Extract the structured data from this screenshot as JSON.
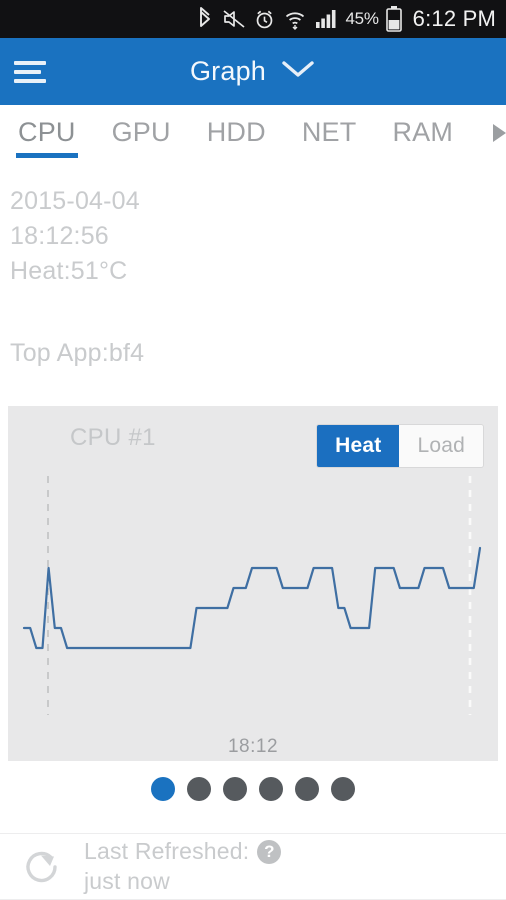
{
  "statusbar": {
    "icons": [
      "bluetooth-icon",
      "mute-icon",
      "alarm-icon",
      "wifi-icon",
      "signal-icon"
    ],
    "battery_percent": "45%",
    "time": "6:12 PM"
  },
  "appbar": {
    "menu_icon": "hamburger-menu-icon",
    "title": "Graph",
    "dropdown_icon": "chevron-down-icon",
    "color": "#1a72c0"
  },
  "tabs": {
    "items": [
      {
        "label": "CPU",
        "active": true
      },
      {
        "label": "GPU",
        "active": false
      },
      {
        "label": "HDD",
        "active": false
      },
      {
        "label": "NET",
        "active": false
      },
      {
        "label": "RAM",
        "active": false
      }
    ],
    "overflow_icon": "caret-right-icon",
    "indicator_color": "#1a72c0"
  },
  "info": {
    "date": "2015-04-04",
    "time": "18:12:56",
    "heat": "Heat:51°C",
    "top_app": "Top App:bf4"
  },
  "chart_card": {
    "title": "CPU #1",
    "toggle": {
      "selected": "Heat",
      "options": [
        "Heat",
        "Load"
      ],
      "selected_color": "#1b6fc0"
    }
  },
  "chart_data": {
    "type": "line",
    "title": "CPU #1",
    "xlabel": "",
    "ylabel": "",
    "x_tick_labels": [
      "18:12"
    ],
    "series": [
      {
        "name": "Heat",
        "color": "#3f6fa3",
        "values": [
          51,
          51,
          50,
          50,
          54,
          51,
          51,
          50,
          50,
          50,
          50,
          50,
          50,
          50,
          50,
          50,
          50,
          50,
          50,
          50,
          50,
          50,
          50,
          50,
          50,
          50,
          50,
          50,
          52,
          52,
          52,
          52,
          52,
          52,
          53,
          53,
          53,
          54,
          54,
          54,
          54,
          54,
          53,
          53,
          53,
          53,
          53,
          54,
          54,
          54,
          54,
          52,
          52,
          51,
          51,
          51,
          51,
          54,
          54,
          54,
          54,
          53,
          53,
          53,
          53,
          54,
          54,
          54,
          54,
          53,
          53,
          53,
          53,
          53,
          55
        ]
      }
    ],
    "ylim": [
      49,
      56
    ],
    "grid": false,
    "legend": "none",
    "vertical_marker_lines": 2
  },
  "pager": {
    "count": 6,
    "active_index": 0,
    "active_color": "#1a72c0",
    "inactive_color": "#565a5e"
  },
  "footer": {
    "refresh_icon": "refresh-icon",
    "label": "Last Refreshed:",
    "help_icon": "?",
    "value": "just now"
  }
}
